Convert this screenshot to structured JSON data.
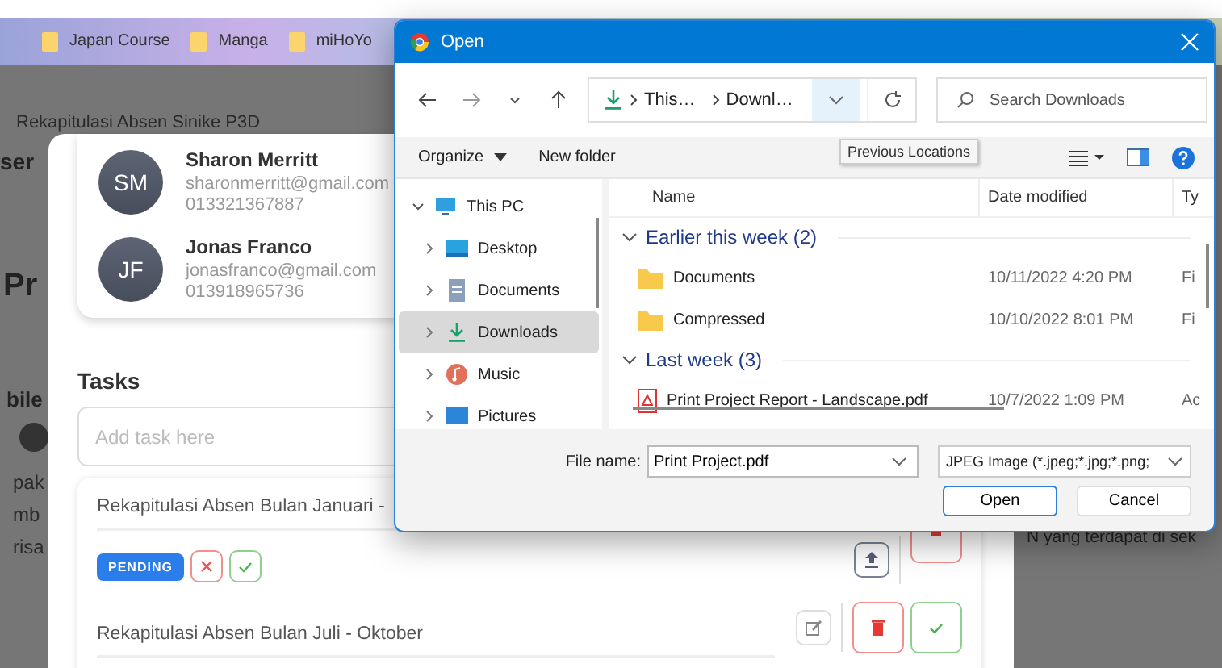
{
  "bookmarks": [
    {
      "label": "Japan Course"
    },
    {
      "label": "Manga"
    },
    {
      "label": "miHoYo"
    }
  ],
  "background_page": {
    "fragments": [
      "Rekapitulasi Absen Sinike P3D",
      "ser",
      "Pr",
      "bile",
      "pak",
      "mb",
      "risa",
      "N yang terdapat di sek"
    ]
  },
  "modal": {
    "contacts": [
      {
        "initials": "SM",
        "name": "Sharon Merritt",
        "email": "sharonmerritt@gmail.com",
        "phone": "013321367887"
      },
      {
        "initials": "JF",
        "name": "Jonas Franco",
        "email": "jonasfranco@gmail.com",
        "phone": "013918965736"
      }
    ],
    "tasks_heading": "Tasks",
    "task_input": {
      "placeholder": "Add task here"
    },
    "tasks": [
      {
        "title": "Rekapitulasi Absen Bulan Januari -",
        "status": "PENDING",
        "kind": "pending"
      },
      {
        "title": "Rekapitulasi Absen Bulan Juli - Oktober",
        "kind": "editable"
      }
    ]
  },
  "dialog": {
    "title": "Open",
    "path": [
      "This…",
      "Downl…"
    ],
    "search": {
      "placeholder": "Search Downloads"
    },
    "tooltip": "Previous Locations",
    "toolbar": [
      "Organize",
      "New folder"
    ],
    "tree": [
      {
        "label": "This PC",
        "kind": "pc",
        "expanded": true,
        "selected": false,
        "children": [
          {
            "label": "Desktop",
            "kind": "desktop",
            "expanded": false,
            "selected": false
          },
          {
            "label": "Documents",
            "kind": "documents",
            "expanded": false,
            "selected": false
          },
          {
            "label": "Downloads",
            "kind": "downloads",
            "expanded": false,
            "selected": true
          },
          {
            "label": "Music",
            "kind": "music",
            "expanded": false,
            "selected": false
          },
          {
            "label": "Pictures",
            "kind": "pictures",
            "expanded": false,
            "selected": false
          }
        ]
      }
    ],
    "columns": [
      "Name",
      "Date modified",
      "Ty"
    ],
    "groups": [
      {
        "label": "Earlier this week (2)",
        "expanded": true,
        "files": [
          {
            "name": "Documents",
            "date": "10/11/2022 4:20 PM",
            "type": "Fi",
            "kind": "folder"
          },
          {
            "name": "Compressed",
            "date": "10/10/2022 8:01 PM",
            "type": "Fi",
            "kind": "folder"
          }
        ]
      },
      {
        "label": "Last week (3)",
        "expanded": true,
        "files": [
          {
            "name": "Print Project Report - Landscape.pdf",
            "date": "10/7/2022 1:09 PM",
            "type": "Ac",
            "kind": "pdf"
          }
        ]
      }
    ],
    "file_name_label": "File name:",
    "file_name": "Print Project.pdf",
    "file_type": "JPEG Image (*.jpeg;*.jpg;*.png;",
    "buttons": [
      "Open",
      "Cancel"
    ]
  }
}
